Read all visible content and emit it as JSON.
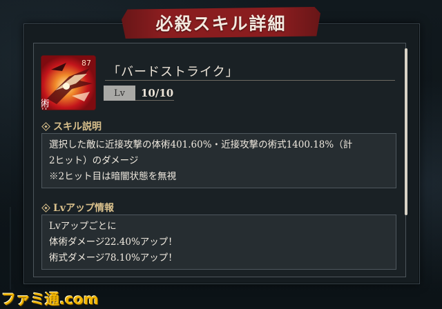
{
  "title": "必殺スキル詳細",
  "skill": {
    "name": "「バードストライク」",
    "icon_text": "術体",
    "icon_number": "87",
    "level_label": "Lv",
    "level_value": "10/10"
  },
  "description": {
    "heading": "スキル説明",
    "lines": [
      "選択した敵に近接攻撃の体術401.60%・近接攻撃の術式1400.18%（計",
      "2ヒット）のダメージ",
      "※2ヒット目は暗闇状態を無視"
    ]
  },
  "levelup": {
    "heading": "Lvアップ情報",
    "lines": [
      "Lvアップごとに",
      "体術ダメージ22.40%アップ！",
      "術式ダメージ78.10%アップ！"
    ]
  },
  "watermark": "ファミ通.com",
  "colors": {
    "banner": "#8a1d1f",
    "section_heading": "#d9c08c",
    "icon_bg": "#b40e12"
  }
}
